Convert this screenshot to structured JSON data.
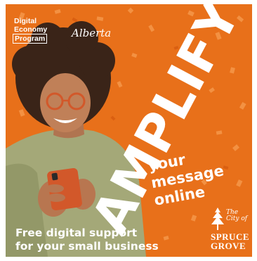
{
  "ad": {
    "program_line1": "Digital",
    "program_line2": "Economy",
    "program_line3": "Program",
    "alberta_logo": "Alberta",
    "headline": "AMPLIFY",
    "tagline_line1": "your",
    "tagline_line2": "message",
    "tagline_line3": "online",
    "footer_line1": "Free digital support",
    "footer_line2": "for your small business",
    "city_the": "The",
    "city_of": "City of",
    "city_name1": "SPRUCE",
    "city_name2": "GROVE"
  },
  "colors": {
    "background": "#e8701a",
    "confetti": "#f59a4a",
    "text": "#ffffff"
  }
}
